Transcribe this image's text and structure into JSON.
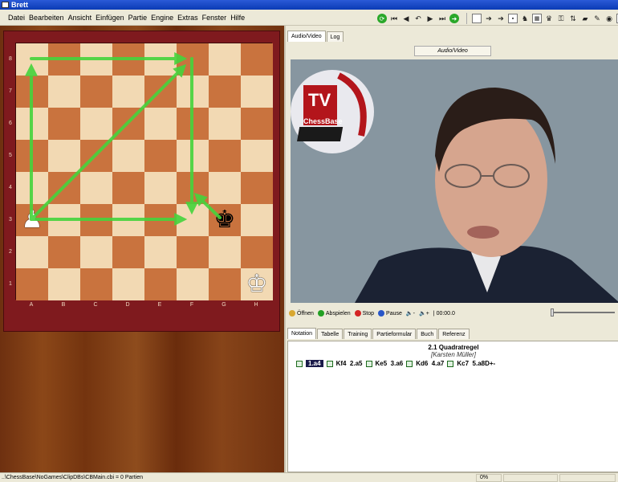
{
  "window": {
    "title": "Brett"
  },
  "menu": [
    "Datei",
    "Bearbeiten",
    "Ansicht",
    "Einfügen",
    "Partie",
    "Engine",
    "Extras",
    "Fenster",
    "Hilfe"
  ],
  "board": {
    "ranks": [
      "8",
      "7",
      "6",
      "5",
      "4",
      "3",
      "2",
      "1"
    ],
    "files": [
      "A",
      "B",
      "C",
      "D",
      "E",
      "F",
      "G",
      "H"
    ]
  },
  "video_panel": {
    "tabs": [
      "Audio/Video",
      "Log"
    ],
    "header": "Audio/Video",
    "logo_text_1": "TV",
    "logo_text_2": "ChessBase"
  },
  "controls": {
    "open": "Öffnen",
    "play": "Abspielen",
    "stop": "Stop",
    "pause": "Pause",
    "vol_down": "-",
    "vol_up": "+",
    "time": "00:00.0"
  },
  "notation": {
    "tabs": [
      "Notation",
      "Tabelle",
      "Training",
      "Partieformular",
      "Buch",
      "Referenz"
    ],
    "title": "2.1 Quadratregel",
    "author": "[Karsten Müller]",
    "moves": [
      "1.a4",
      "Kf4",
      "2.a5",
      "Ke5",
      "3.a6",
      "Kd6",
      "4.a7",
      "Kc7",
      "5.a8D+-"
    ]
  },
  "status": {
    "path": "..\\ChessBase\\NoGames\\ClipDBs\\CBMain.cbi = 0 Partien",
    "percent": "0%"
  },
  "colors": {
    "arrow": "#45d43c",
    "light_square": "#f2d9b3",
    "dark_square": "#c9733e",
    "frame": "#7f1a1e"
  }
}
